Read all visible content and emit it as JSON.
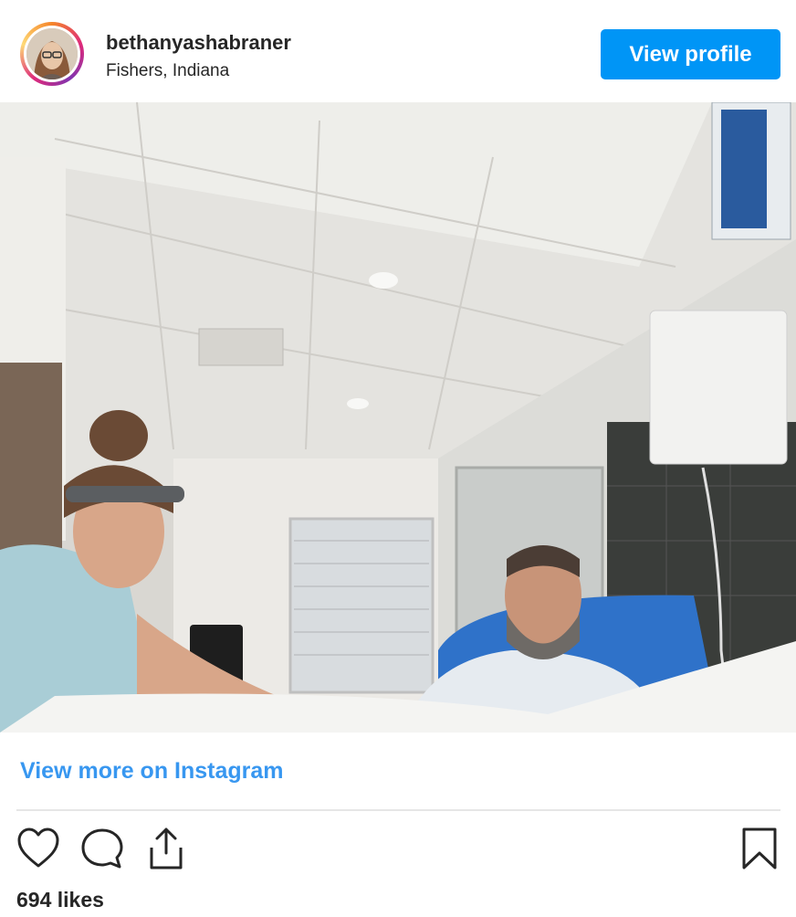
{
  "post": {
    "username": "bethanyashabraner",
    "location": "Fishers, Indiana",
    "view_profile_label": "View profile",
    "view_more_label": "View more on Instagram",
    "likes": "694 likes"
  },
  "icons": {
    "like": "heart-icon",
    "comment": "comment-icon",
    "share": "share-icon",
    "save": "bookmark-icon"
  },
  "colors": {
    "button_blue": "#0095f6",
    "link_blue": "#3897f0",
    "text": "#262626"
  }
}
